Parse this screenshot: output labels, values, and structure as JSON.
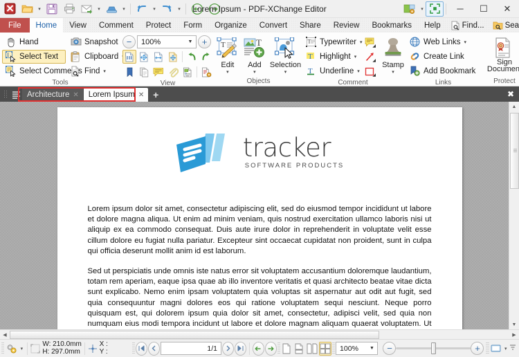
{
  "window": {
    "title": "Lorem Ipsum - PDF-XChange Editor",
    "minimize_label": "─",
    "maximize_label": "☐",
    "close_label": "✕"
  },
  "quick_access": {
    "items": [
      {
        "name": "app-logo-icon",
        "label": "PDF-XChange Editor"
      },
      {
        "name": "open-icon",
        "label": "Open"
      },
      {
        "name": "save-icon",
        "label": "Save"
      },
      {
        "name": "print-icon",
        "label": "Print"
      },
      {
        "name": "email-icon",
        "label": "Email"
      },
      {
        "name": "scan-icon",
        "label": "Scan"
      },
      {
        "name": "undo-icon",
        "label": "Undo"
      },
      {
        "name": "redo-icon",
        "label": "Redo"
      },
      {
        "name": "previous-view-icon",
        "label": "Previous View"
      },
      {
        "name": "next-view-icon",
        "label": "Next View"
      }
    ],
    "caret": "▾"
  },
  "title_right": {
    "customize_label": "Customize",
    "fullscreen_label": "Full Screen"
  },
  "menu": {
    "file": "File",
    "items": [
      {
        "label": "Home",
        "active": true
      },
      {
        "label": "View",
        "active": false
      },
      {
        "label": "Comment",
        "active": false
      },
      {
        "label": "Protect",
        "active": false
      },
      {
        "label": "Form",
        "active": false
      },
      {
        "label": "Organize",
        "active": false
      },
      {
        "label": "Convert",
        "active": false
      },
      {
        "label": "Share",
        "active": false
      },
      {
        "label": "Review",
        "active": false
      },
      {
        "label": "Bookmarks",
        "active": false
      },
      {
        "label": "Help",
        "active": false
      }
    ],
    "find": "Find...",
    "search": "Search...",
    "collapse": "∧"
  },
  "ribbon": {
    "groups": [
      {
        "name": "tools",
        "label": "Tools",
        "items": [
          {
            "label": "Hand",
            "icon": "hand-icon",
            "selected": false,
            "caret": false
          },
          {
            "label": "Select Text",
            "icon": "select-text-icon",
            "selected": true,
            "caret": false
          },
          {
            "label": "Select Comments",
            "icon": "select-comments-icon",
            "selected": false,
            "caret": false
          },
          {
            "label": "Snapshot",
            "icon": "snapshot-icon",
            "selected": false,
            "caret": false
          },
          {
            "label": "Clipboard",
            "icon": "clipboard-icon",
            "selected": false,
            "caret": true
          },
          {
            "label": "Find",
            "icon": "find-icon",
            "selected": false,
            "caret": true
          }
        ]
      },
      {
        "name": "view",
        "label": "View",
        "zoom_value": "100%",
        "zoom_out": "−",
        "zoom_in": "+",
        "icons_row1": [
          "fit-page-icon",
          "fit-width-icon",
          "fit-visible-icon",
          "actual-size-icon",
          "rotate-left-icon",
          "rotate-right-icon"
        ],
        "icons_row2": [
          "bookmarks-pane-icon",
          "thumbnails-pane-icon",
          "comments-pane-icon",
          "attachments-pane-icon",
          "content-pane-icon",
          "properties-icon"
        ]
      },
      {
        "name": "objects",
        "label": "Objects",
        "buttons": [
          {
            "label": "Edit",
            "icon": "edit-content-icon",
            "caret": "▾"
          },
          {
            "label": "Add",
            "icon": "add-content-icon",
            "caret": "▾"
          },
          {
            "label": "Selection",
            "icon": "selection-icon",
            "caret": "▾"
          }
        ]
      },
      {
        "name": "comment",
        "label": "Comment",
        "items": [
          {
            "label": "Typewriter",
            "icon": "typewriter-icon",
            "caret": true
          },
          {
            "label": "Highlight",
            "icon": "highlight-icon",
            "caret": true
          },
          {
            "label": "Underline",
            "icon": "underline-icon",
            "caret": true
          }
        ],
        "tool_icons": [
          {
            "name": "sticky-note-icon",
            "caret": true
          },
          {
            "name": "arrow-annotation-icon",
            "caret": true
          },
          {
            "name": "rectangle-annotation-icon",
            "caret": true
          }
        ],
        "stamp": {
          "label": "Stamp",
          "icon": "stamp-icon",
          "caret": "▾"
        }
      },
      {
        "name": "links",
        "label": "Links",
        "items": [
          {
            "label": "Web Links",
            "icon": "web-links-icon",
            "caret": true
          },
          {
            "label": "Create Link",
            "icon": "create-link-icon",
            "caret": false
          },
          {
            "label": "Add Bookmark",
            "icon": "add-bookmark-icon",
            "caret": false
          }
        ]
      },
      {
        "name": "protect",
        "label": "Protect",
        "buttons": [
          {
            "label": "Sign Document",
            "icon": "sign-document-icon",
            "caret": ""
          }
        ]
      }
    ]
  },
  "document_tabs": {
    "tabs": [
      {
        "label": "Architecture",
        "active": false,
        "close": "✕"
      },
      {
        "label": "Lorem Ipsum",
        "active": true,
        "close": "✕"
      }
    ],
    "add_label": "+",
    "close_all_label": "✖",
    "highlight_color": "#e03030"
  },
  "page_content": {
    "logo": {
      "name": "tracker",
      "tagline": "SOFTWARE PRODUCTS"
    },
    "paragraphs": [
      "Lorem ipsum dolor sit amet, consectetur adipiscing elit, sed do eiusmod tempor incididunt ut labore et dolore magna aliqua. Ut enim ad minim veniam, quis nostrud exercitation ullamco laboris nisi ut aliquip ex ea commodo consequat. Duis aute irure dolor in reprehenderit in voluptate velit esse cillum dolore eu fugiat nulla pariatur. Excepteur sint occaecat cupidatat non proident, sunt in culpa qui officia deserunt mollit anim id est laborum.",
      "Sed ut perspiciatis unde omnis iste natus error sit voluptatem accusantium doloremque laudantium, totam rem aperiam, eaque ipsa quae ab illo inventore veritatis et quasi architecto beatae vitae dicta sunt explicabo. Nemo enim ipsam voluptatem quia voluptas sit aspernatur aut odit aut fugit, sed quia consequuntur magni dolores eos qui ratione voluptatem sequi nesciunt. Neque porro quisquam est, qui dolorem ipsum quia dolor sit amet, consectetur, adipisci velit, sed quia non numquam eius modi tempora incidunt ut labore et dolore magnam aliquam quaerat voluptatem. Ut enim ad minima veniam, quis nostrum exercitationem ullam corporis suscipit laboriosam, nisi ut aliquid ex ea commodi consequatur? Quis autem vel eum iure reprehenderit qui in ea voluptate velit esse quam nihil molestiae consequatur, vel"
    ]
  },
  "status_bar": {
    "settings_icon": "settings-icon",
    "settings_caret": "▾",
    "page_size_icon": "page-size-icon",
    "width_label": "W: 210.0mm",
    "height_label": "H: 297.0mm",
    "cursor_icon": "cursor-position-icon",
    "x_label": "X :",
    "y_label": "Y :",
    "nav": {
      "first": "❘◂",
      "prev": "‹",
      "page_value": "1/1",
      "next": "›",
      "last": "▸❘"
    },
    "history": {
      "back": "←",
      "forward": "→"
    },
    "layout_icons": [
      "single-page-icon",
      "single-page-continuous-icon",
      "two-pages-icon",
      "two-pages-continuous-icon"
    ],
    "zoom_value": "100%",
    "zoom_out": "−",
    "zoom_in": "+",
    "fullscreen_icon": "fullscreen-icon",
    "fullscreen_caret": "▾",
    "resize_grip": "resize-grip-icon"
  }
}
